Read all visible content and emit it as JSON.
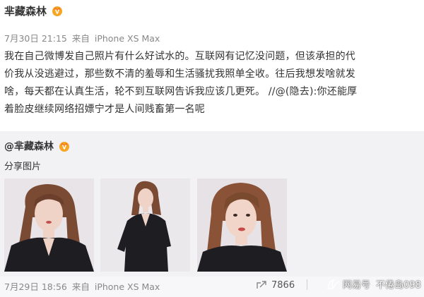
{
  "post": {
    "author": "芈藏森林",
    "date": "7月30日 21:15",
    "source_prefix": "来自",
    "device": "iPhone XS Max",
    "lines": [
      "我在自己微博发自己照片有什么好试水的。互联网有记忆没问题，但该承担的代",
      "价我从没逃避过，那些数不清的羞辱和生活骚扰我照单全收。往后我想发啥就发",
      "啥，每天都在认真生活，轮不到互联网告诉我应该几更死。 //",
      "着脸皮继续网络招嫖宁才是人间贱畜第一名呢"
    ],
    "repost_author": "@(隐去)",
    "repost_text": ":你还能厚"
  },
  "quoted": {
    "author": "@芈藏森林",
    "text": "分享图片",
    "photos": [
      {
        "label": "photo-1"
      },
      {
        "label": "photo-2"
      },
      {
        "label": "photo-3"
      }
    ],
    "date": "7月29日 18:56",
    "source_prefix": "来自",
    "device": "iPhone XS Max",
    "shares": "7866"
  },
  "watermark": {
    "brand": "网易号",
    "account": "不倦岛098"
  },
  "colors": {
    "quoted_bg": "#f2f2f5",
    "meta_text": "#888888",
    "badge": "#f5a623"
  }
}
